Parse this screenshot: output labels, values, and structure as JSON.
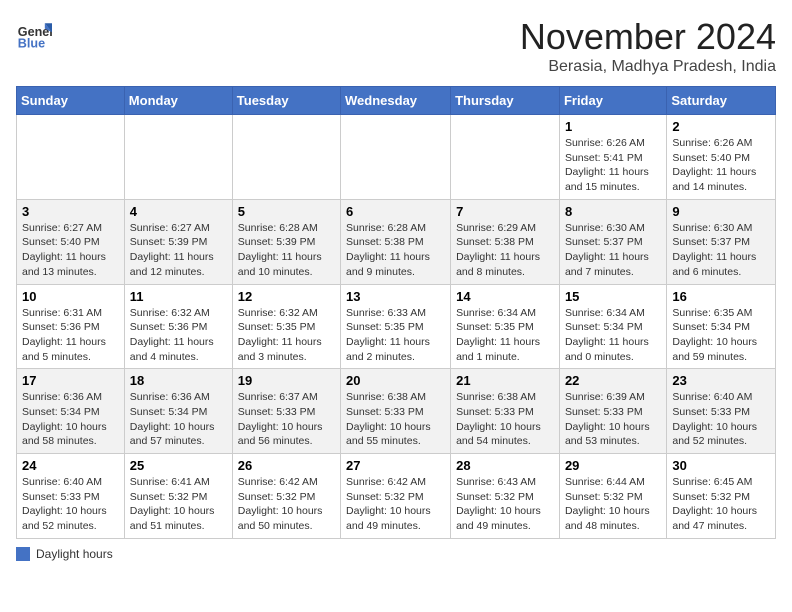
{
  "app": {
    "name": "GeneralBlue",
    "logo_icon": "🔷"
  },
  "header": {
    "month_title": "November 2024",
    "location": "Berasia, Madhya Pradesh, India"
  },
  "weekdays": [
    "Sunday",
    "Monday",
    "Tuesday",
    "Wednesday",
    "Thursday",
    "Friday",
    "Saturday"
  ],
  "legend": {
    "label": "Daylight hours"
  },
  "weeks": [
    [
      {
        "day": "",
        "info": ""
      },
      {
        "day": "",
        "info": ""
      },
      {
        "day": "",
        "info": ""
      },
      {
        "day": "",
        "info": ""
      },
      {
        "day": "",
        "info": ""
      },
      {
        "day": "1",
        "info": "Sunrise: 6:26 AM\nSunset: 5:41 PM\nDaylight: 11 hours\nand 15 minutes."
      },
      {
        "day": "2",
        "info": "Sunrise: 6:26 AM\nSunset: 5:40 PM\nDaylight: 11 hours\nand 14 minutes."
      }
    ],
    [
      {
        "day": "3",
        "info": "Sunrise: 6:27 AM\nSunset: 5:40 PM\nDaylight: 11 hours\nand 13 minutes."
      },
      {
        "day": "4",
        "info": "Sunrise: 6:27 AM\nSunset: 5:39 PM\nDaylight: 11 hours\nand 12 minutes."
      },
      {
        "day": "5",
        "info": "Sunrise: 6:28 AM\nSunset: 5:39 PM\nDaylight: 11 hours\nand 10 minutes."
      },
      {
        "day": "6",
        "info": "Sunrise: 6:28 AM\nSunset: 5:38 PM\nDaylight: 11 hours\nand 9 minutes."
      },
      {
        "day": "7",
        "info": "Sunrise: 6:29 AM\nSunset: 5:38 PM\nDaylight: 11 hours\nand 8 minutes."
      },
      {
        "day": "8",
        "info": "Sunrise: 6:30 AM\nSunset: 5:37 PM\nDaylight: 11 hours\nand 7 minutes."
      },
      {
        "day": "9",
        "info": "Sunrise: 6:30 AM\nSunset: 5:37 PM\nDaylight: 11 hours\nand 6 minutes."
      }
    ],
    [
      {
        "day": "10",
        "info": "Sunrise: 6:31 AM\nSunset: 5:36 PM\nDaylight: 11 hours\nand 5 minutes."
      },
      {
        "day": "11",
        "info": "Sunrise: 6:32 AM\nSunset: 5:36 PM\nDaylight: 11 hours\nand 4 minutes."
      },
      {
        "day": "12",
        "info": "Sunrise: 6:32 AM\nSunset: 5:35 PM\nDaylight: 11 hours\nand 3 minutes."
      },
      {
        "day": "13",
        "info": "Sunrise: 6:33 AM\nSunset: 5:35 PM\nDaylight: 11 hours\nand 2 minutes."
      },
      {
        "day": "14",
        "info": "Sunrise: 6:34 AM\nSunset: 5:35 PM\nDaylight: 11 hours\nand 1 minute."
      },
      {
        "day": "15",
        "info": "Sunrise: 6:34 AM\nSunset: 5:34 PM\nDaylight: 11 hours\nand 0 minutes."
      },
      {
        "day": "16",
        "info": "Sunrise: 6:35 AM\nSunset: 5:34 PM\nDaylight: 10 hours\nand 59 minutes."
      }
    ],
    [
      {
        "day": "17",
        "info": "Sunrise: 6:36 AM\nSunset: 5:34 PM\nDaylight: 10 hours\nand 58 minutes."
      },
      {
        "day": "18",
        "info": "Sunrise: 6:36 AM\nSunset: 5:34 PM\nDaylight: 10 hours\nand 57 minutes."
      },
      {
        "day": "19",
        "info": "Sunrise: 6:37 AM\nSunset: 5:33 PM\nDaylight: 10 hours\nand 56 minutes."
      },
      {
        "day": "20",
        "info": "Sunrise: 6:38 AM\nSunset: 5:33 PM\nDaylight: 10 hours\nand 55 minutes."
      },
      {
        "day": "21",
        "info": "Sunrise: 6:38 AM\nSunset: 5:33 PM\nDaylight: 10 hours\nand 54 minutes."
      },
      {
        "day": "22",
        "info": "Sunrise: 6:39 AM\nSunset: 5:33 PM\nDaylight: 10 hours\nand 53 minutes."
      },
      {
        "day": "23",
        "info": "Sunrise: 6:40 AM\nSunset: 5:33 PM\nDaylight: 10 hours\nand 52 minutes."
      }
    ],
    [
      {
        "day": "24",
        "info": "Sunrise: 6:40 AM\nSunset: 5:33 PM\nDaylight: 10 hours\nand 52 minutes."
      },
      {
        "day": "25",
        "info": "Sunrise: 6:41 AM\nSunset: 5:32 PM\nDaylight: 10 hours\nand 51 minutes."
      },
      {
        "day": "26",
        "info": "Sunrise: 6:42 AM\nSunset: 5:32 PM\nDaylight: 10 hours\nand 50 minutes."
      },
      {
        "day": "27",
        "info": "Sunrise: 6:42 AM\nSunset: 5:32 PM\nDaylight: 10 hours\nand 49 minutes."
      },
      {
        "day": "28",
        "info": "Sunrise: 6:43 AM\nSunset: 5:32 PM\nDaylight: 10 hours\nand 49 minutes."
      },
      {
        "day": "29",
        "info": "Sunrise: 6:44 AM\nSunset: 5:32 PM\nDaylight: 10 hours\nand 48 minutes."
      },
      {
        "day": "30",
        "info": "Sunrise: 6:45 AM\nSunset: 5:32 PM\nDaylight: 10 hours\nand 47 minutes."
      }
    ]
  ]
}
